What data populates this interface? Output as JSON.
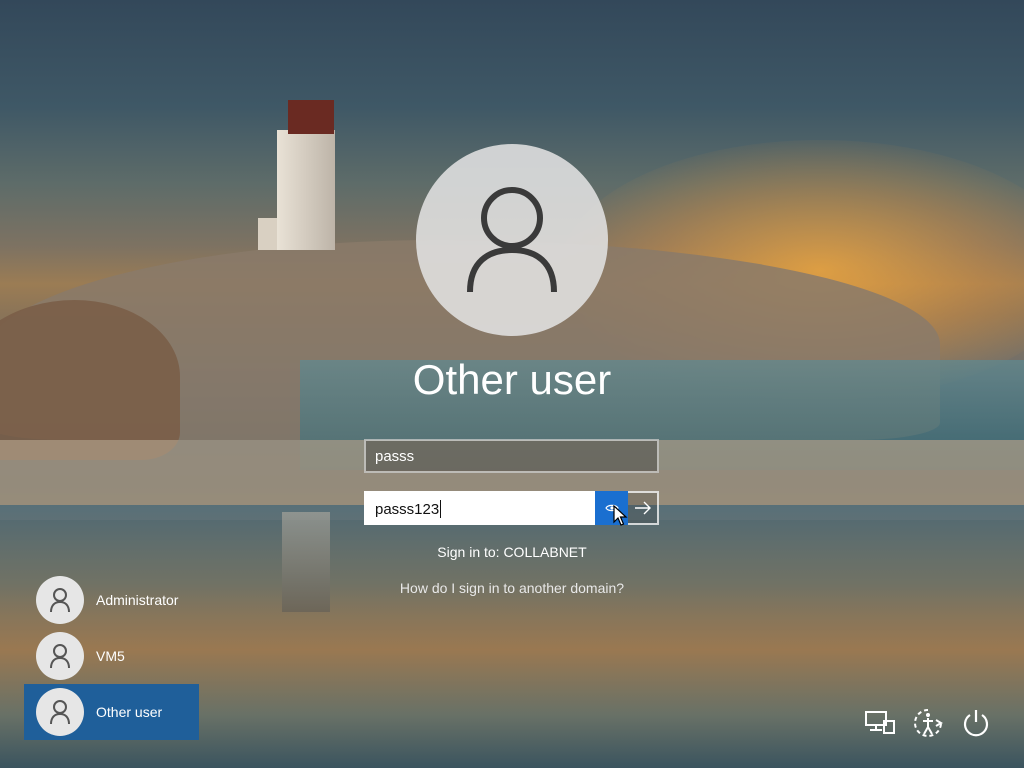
{
  "login": {
    "title": "Other user",
    "username_value": "passs",
    "password_value": "passs123",
    "sign_in_to": "Sign in to: COLLABNET",
    "domain_help_link": "How do I sign in to another domain?"
  },
  "icons": {
    "avatar": "person-icon",
    "reveal": "eye-icon",
    "submit": "arrow-right-icon",
    "network": "network-icon",
    "accessibility": "ease-of-access-icon",
    "power": "power-icon"
  },
  "users": [
    {
      "name": "Administrator",
      "selected": false
    },
    {
      "name": "VM5",
      "selected": false
    },
    {
      "name": "Other user",
      "selected": true
    }
  ],
  "colors": {
    "accent": "#1a6fd0",
    "selected_user": "#1f5f9a"
  }
}
